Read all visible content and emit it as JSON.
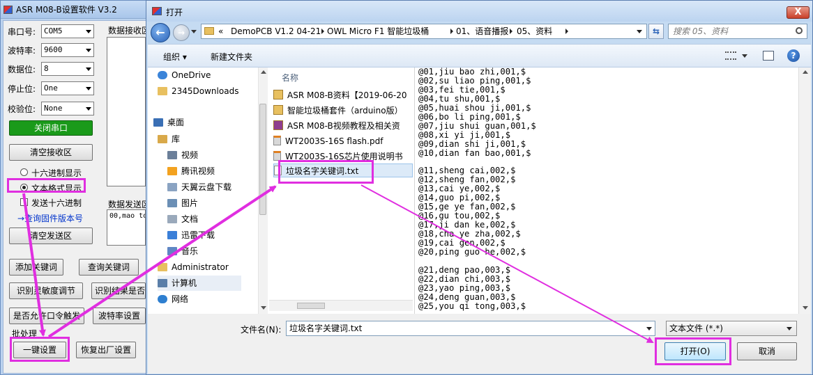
{
  "app": {
    "title": "ASR M08-B设置软件 V3.2",
    "port_label": "串口号:",
    "port_value": "COM5",
    "baud_label": "波特率:",
    "baud_value": "9600",
    "databits_label": "数据位:",
    "databits_value": "8",
    "stopbits_label": "停止位:",
    "stopbits_value": "One",
    "parity_label": "校验位:",
    "parity_value": "None",
    "close_port_btn": "关闭串口",
    "clear_recv_btn": "清空接收区",
    "recv_label": "数据接收区",
    "hex_display": "十六进制显示",
    "text_display": "文本格式显示",
    "send_hex": "发送十六进制",
    "send_label": "数据发送区",
    "send_text": "00,mao to",
    "query_fw_link": "→查询固件版本号",
    "clear_send_btn": "清空发送区",
    "add_kw_btn": "添加关键词",
    "query_kw_btn": "查询关键词",
    "sensitivity_btn": "识别灵敏度调节",
    "result_btn": "识别结果是否",
    "allow_trigger_btn": "是否允许口令触发",
    "baud_set_btn": "波特率设置",
    "batch_label": "批处理",
    "one_key_btn": "一键设置",
    "factory_btn": "恢复出厂设置"
  },
  "dialog": {
    "title": "打开",
    "close": "X",
    "breadcrumb": [
      "«",
      "DemoPCB V1.2 04-21",
      "OWL Micro F1 智能垃圾桶",
      "01、语音播报",
      "05、资料"
    ],
    "search_placeholder": "搜索 05、资料",
    "toolbar": {
      "organize": "组织 ▾",
      "new_folder": "新建文件夹"
    },
    "nav_items": [
      {
        "label": "OneDrive",
        "icon": "cloud-icon"
      },
      {
        "label": "2345Downloads",
        "icon": "folder-icon"
      },
      {
        "label": "桌面",
        "icon": "desktop-icon"
      },
      {
        "label": "库",
        "icon": "library-icon"
      },
      {
        "label": "视频",
        "icon": "video-icon"
      },
      {
        "label": "腾讯视频",
        "icon": "tencent-video-icon"
      },
      {
        "label": "天翼云盘下载",
        "icon": "download-icon"
      },
      {
        "label": "图片",
        "icon": "pictures-icon"
      },
      {
        "label": "文档",
        "icon": "documents-icon"
      },
      {
        "label": "迅雷下载",
        "icon": "xunlei-icon"
      },
      {
        "label": "音乐",
        "icon": "music-icon"
      },
      {
        "label": "Administrator",
        "icon": "user-folder-icon"
      },
      {
        "label": "计算机",
        "icon": "computer-icon"
      },
      {
        "label": "网络",
        "icon": "network-icon"
      }
    ],
    "column_name": "名称",
    "files": [
      {
        "name": "ASR M08-B资料【2019-06-20",
        "icon": "folder-icon"
      },
      {
        "name": "智能垃圾桶套件（arduino版）",
        "icon": "folder-icon"
      },
      {
        "name": "ASR M08-B视频教程及相关资",
        "icon": "rar-icon"
      },
      {
        "name": "WT2003S-16S flash.pdf",
        "icon": "pdf-icon"
      },
      {
        "name": "WT2003S-16S芯片使用说明书",
        "icon": "pdf-icon"
      },
      {
        "name": "垃圾名字关键词.txt",
        "icon": "txt-icon"
      }
    ],
    "preview_lines": [
      "@01,jiu bao zhi,001,$",
      "@02,su liao ping,001,$",
      "@03,fei tie,001,$",
      "@04,tu shu,001,$",
      "@05,huai shou ji,001,$",
      "@06,bo li ping,001,$",
      "@07,jiu shui guan,001,$",
      "@08,xi yi ji,001,$",
      "@09,dian shi ji,001,$",
      "@10,dian fan bao,001,$",
      "",
      "@11,sheng cai,002,$",
      "@12,sheng fan,002,$",
      "@13,cai ye,002,$",
      "@14,guo pi,002,$",
      "@15,ge ye fan,002,$",
      "@16,gu tou,002,$",
      "@17,ji dan ke,002,$",
      "@18,cha ye zha,002,$",
      "@19,cai gen,002,$",
      "@20,ping guo he,002,$",
      "",
      "@21,deng pao,003,$",
      "@22,dian chi,003,$",
      "@23,yao ping,003,$",
      "@24,deng guan,003,$",
      "@25,you qi tong,003,$"
    ],
    "filename_label": "文件名(N):",
    "filename_value": "垃圾名字关键词.txt",
    "filetype_value": "文本文件 (*.*)",
    "open_btn": "打开(O)",
    "cancel_btn": "取消"
  },
  "colors": {
    "highlight": "#e02ee0",
    "close_port_green": "#1a9a1a",
    "link_blue": "#0033cc"
  }
}
